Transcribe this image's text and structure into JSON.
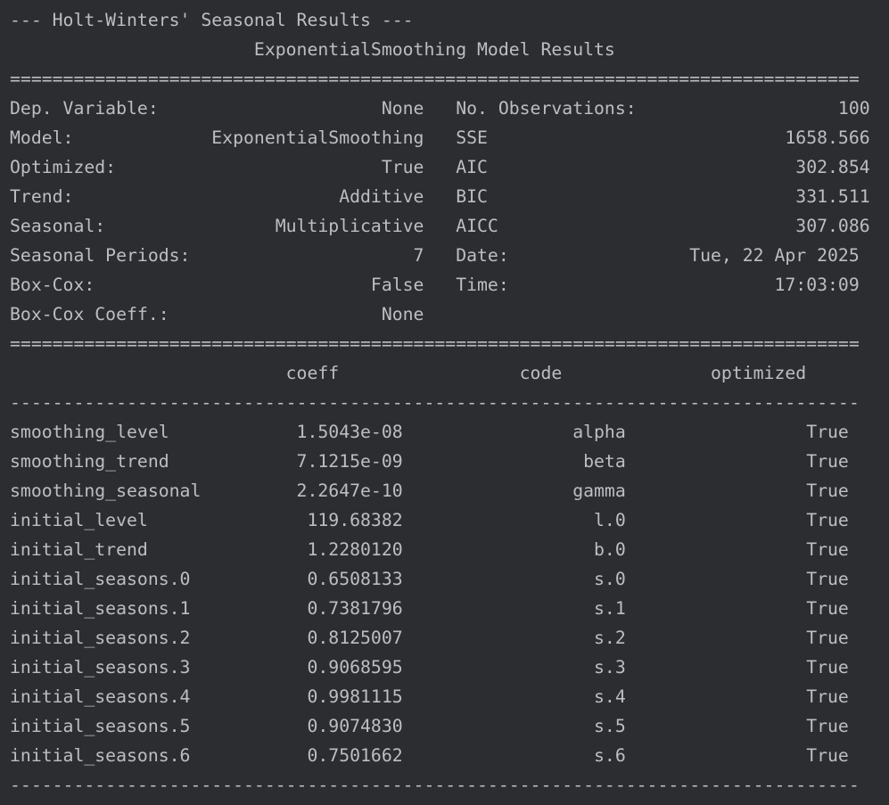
{
  "console": {
    "lines": [
      "--- Holt-Winters' Seasonal Results ---",
      "                       ExponentialSmoothing Model Results                       ",
      "================================================================================",
      "Dep. Variable:                     None   No. Observations:                   100",
      "Model:             ExponentialSmoothing   SSE                            1658.566",
      "Optimized:                         True   AIC                             302.854",
      "Trend:                         Additive   BIC                             331.511",
      "Seasonal:                Multiplicative   AICC                            307.086",
      "Seasonal Periods:                     7   Date:                 Tue, 22 Apr 2025",
      "Box-Cox:                          False   Time:                         17:03:09",
      "Box-Cox Coeff.:                    None                                         ",
      "================================================================================",
      "                          coeff                 code              optimized     ",
      "--------------------------------------------------------------------------------",
      "smoothing_level            1.5043e-08                alpha                 True",
      "smoothing_trend            7.1215e-09                 beta                 True",
      "smoothing_seasonal         2.2647e-10                gamma                 True",
      "initial_level               119.68382                  l.0                 True",
      "initial_trend               1.2280120                  b.0                 True",
      "initial_seasons.0           0.6508133                  s.0                 True",
      "initial_seasons.1           0.7381796                  s.1                 True",
      "initial_seasons.2           0.8125007                  s.2                 True",
      "initial_seasons.3           0.9068595                  s.3                 True",
      "initial_seasons.4           0.9981115                  s.4                 True",
      "initial_seasons.5           0.9074830                  s.5                 True",
      "initial_seasons.6           0.7501662                  s.6                 True",
      "--------------------------------------------------------------------------------"
    ]
  },
  "colors": {
    "background": "#2b2d30",
    "text": "#bcbec4"
  }
}
